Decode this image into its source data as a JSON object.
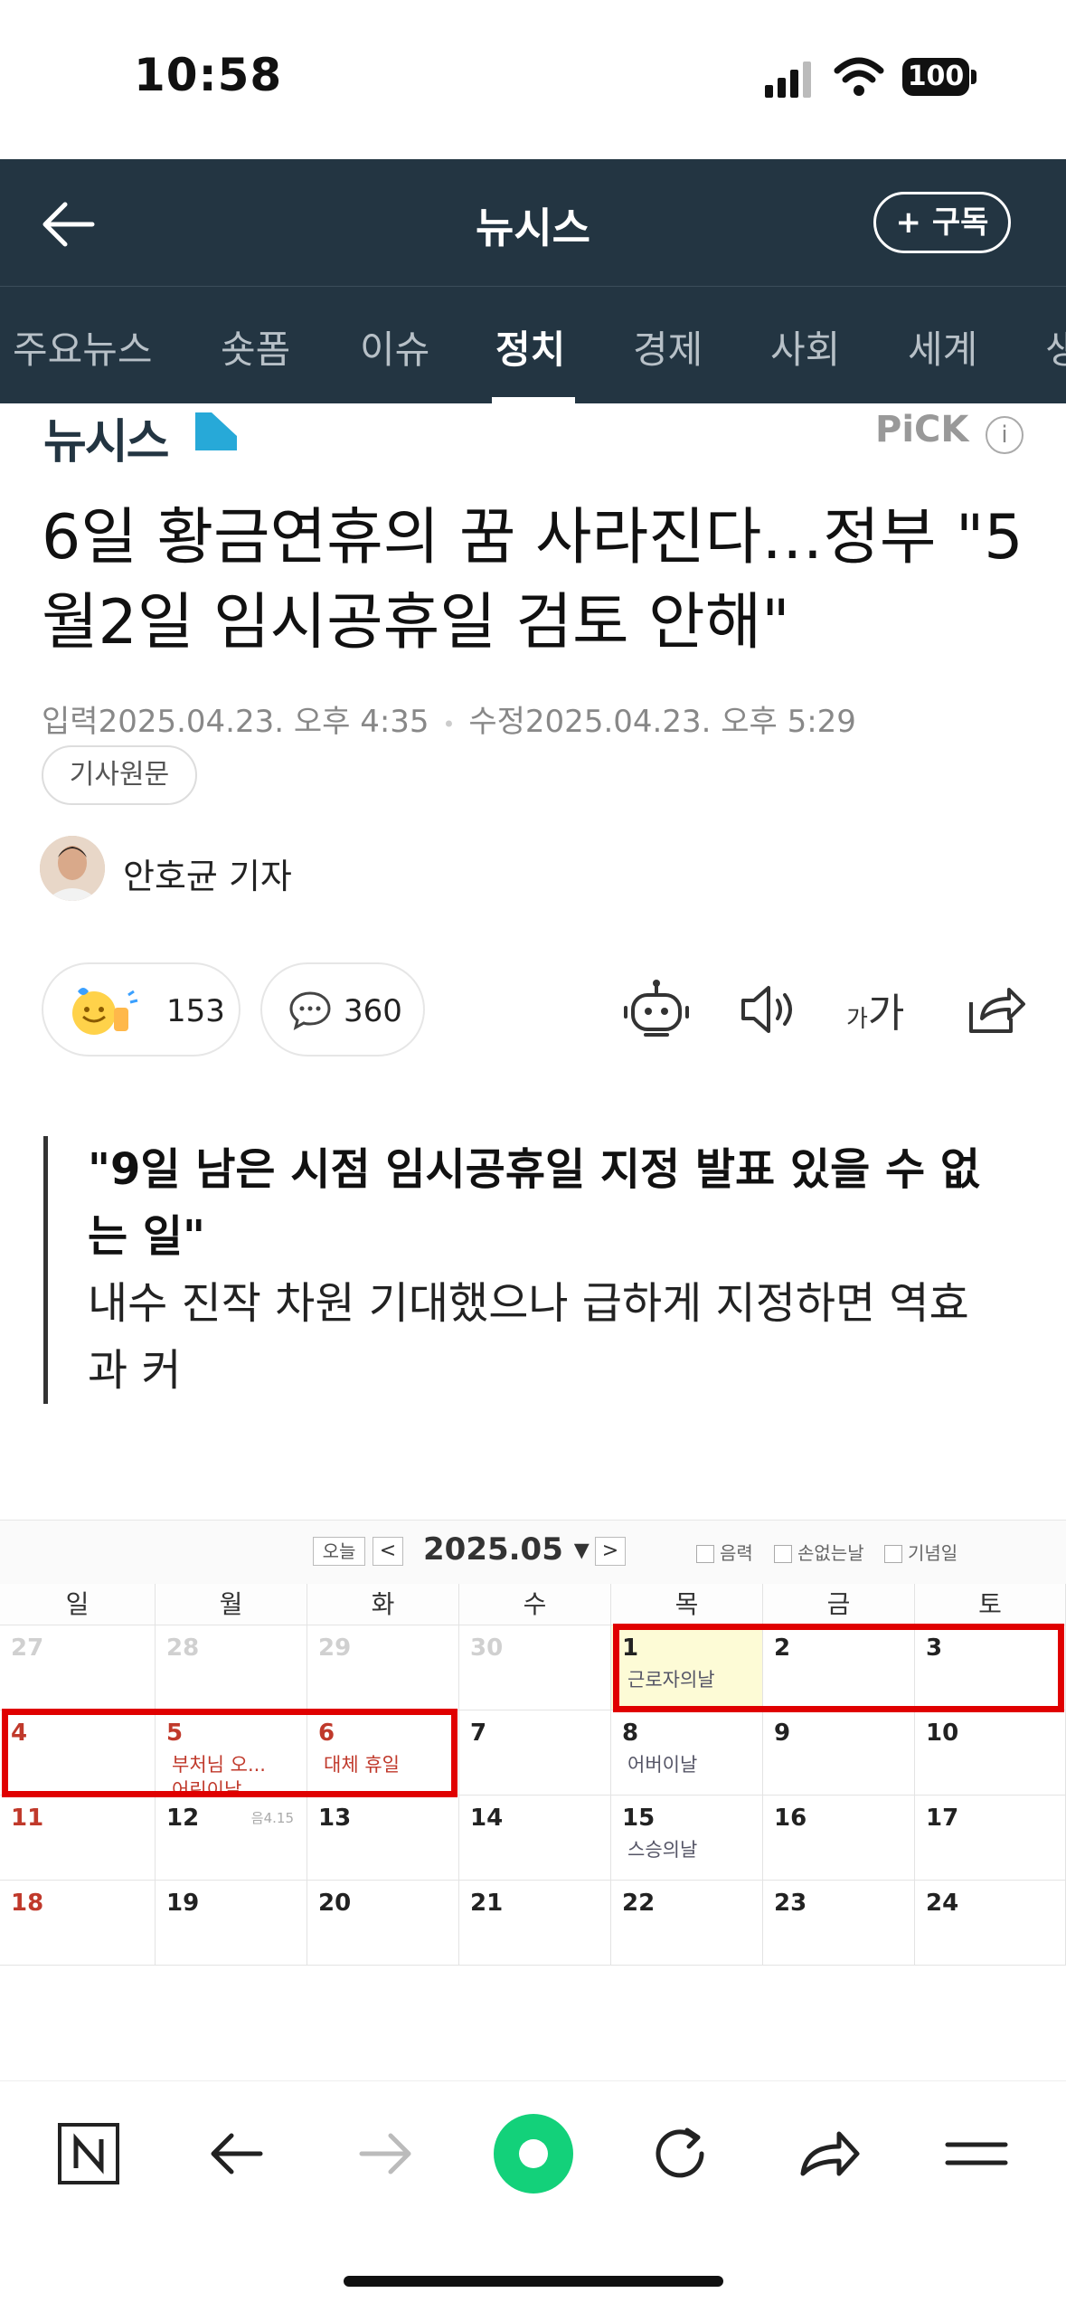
{
  "status_bar": {
    "time": "10:58",
    "battery": "100"
  },
  "navbar": {
    "title": "뉴시스",
    "subscribe_label": "+ 구독"
  },
  "tabs": [
    {
      "label": "주요뉴스"
    },
    {
      "label": "숏폼"
    },
    {
      "label": "이슈"
    },
    {
      "label": "정치",
      "active": true
    },
    {
      "label": "경제"
    },
    {
      "label": "사회"
    },
    {
      "label": "세계"
    },
    {
      "label": "생"
    }
  ],
  "article": {
    "brand": "뉴시스",
    "pick_label": "PiCK",
    "pick_info": "i",
    "headline": "6일 황금연휴의 꿈 사라진다…정부 \"5월2일 임시공휴일 검토 안해\"",
    "input_label": "입력",
    "input_date": "2025.04.23. 오후 4:35",
    "separator": "•",
    "modified_label": "수정",
    "modified_date": "2025.04.23. 오후 5:29",
    "original_button": "기사원문",
    "reporter": "안호균 기자",
    "like_count": "153",
    "comment_count": "360",
    "font_tool_small": "가",
    "font_tool_large": "가",
    "summary": [
      {
        "text": "\"9일 남은 시점 임시공휴일 지정 발표 있을 수 없",
        "bold": true
      },
      {
        "text": "는 일\"",
        "bold": true
      },
      {
        "text": "내수 진작 차원 기대했으나 급하게 지정하면 역효",
        "bold": false
      },
      {
        "text": "과 커",
        "bold": false
      }
    ]
  },
  "calendar": {
    "today_label": "오늘",
    "prev": "<",
    "next": ">",
    "month_label": "2025.05 ▾",
    "checkboxes": [
      "음력",
      "손없는날",
      "기념일"
    ],
    "weekdays": [
      "일",
      "월",
      "화",
      "수",
      "목",
      "금",
      "토"
    ],
    "weeks": [
      [
        {
          "d": "27",
          "grey": true
        },
        {
          "d": "28",
          "grey": true
        },
        {
          "d": "29",
          "grey": true
        },
        {
          "d": "30",
          "grey": true
        },
        {
          "d": "1",
          "events": [
            "근로자의날"
          ],
          "yellow": true
        },
        {
          "d": "2"
        },
        {
          "d": "3"
        }
      ],
      [
        {
          "d": "4",
          "red": true
        },
        {
          "d": "5",
          "red": true,
          "events": [
            "부처님 오...",
            "어린이날"
          ],
          "red_events": true
        },
        {
          "d": "6",
          "red": true,
          "events": [
            "대체 휴일"
          ],
          "red_events": true
        },
        {
          "d": "7"
        },
        {
          "d": "8",
          "events": [
            "어버이날"
          ]
        },
        {
          "d": "9"
        },
        {
          "d": "10"
        }
      ],
      [
        {
          "d": "11",
          "red": true
        },
        {
          "d": "12",
          "lunar": "음4.15"
        },
        {
          "d": "13"
        },
        {
          "d": "14"
        },
        {
          "d": "15",
          "events": [
            "스승의날"
          ]
        },
        {
          "d": "16"
        },
        {
          "d": "17"
        }
      ],
      [
        {
          "d": "18",
          "red": true
        },
        {
          "d": "19"
        },
        {
          "d": "20"
        },
        {
          "d": "21"
        },
        {
          "d": "22"
        },
        {
          "d": "23"
        },
        {
          "d": "24"
        }
      ]
    ]
  },
  "colors": {
    "navbar": "#233542",
    "highlight": "#e00000",
    "holiday": "#c0392b",
    "accent_green": "#13d17a"
  }
}
